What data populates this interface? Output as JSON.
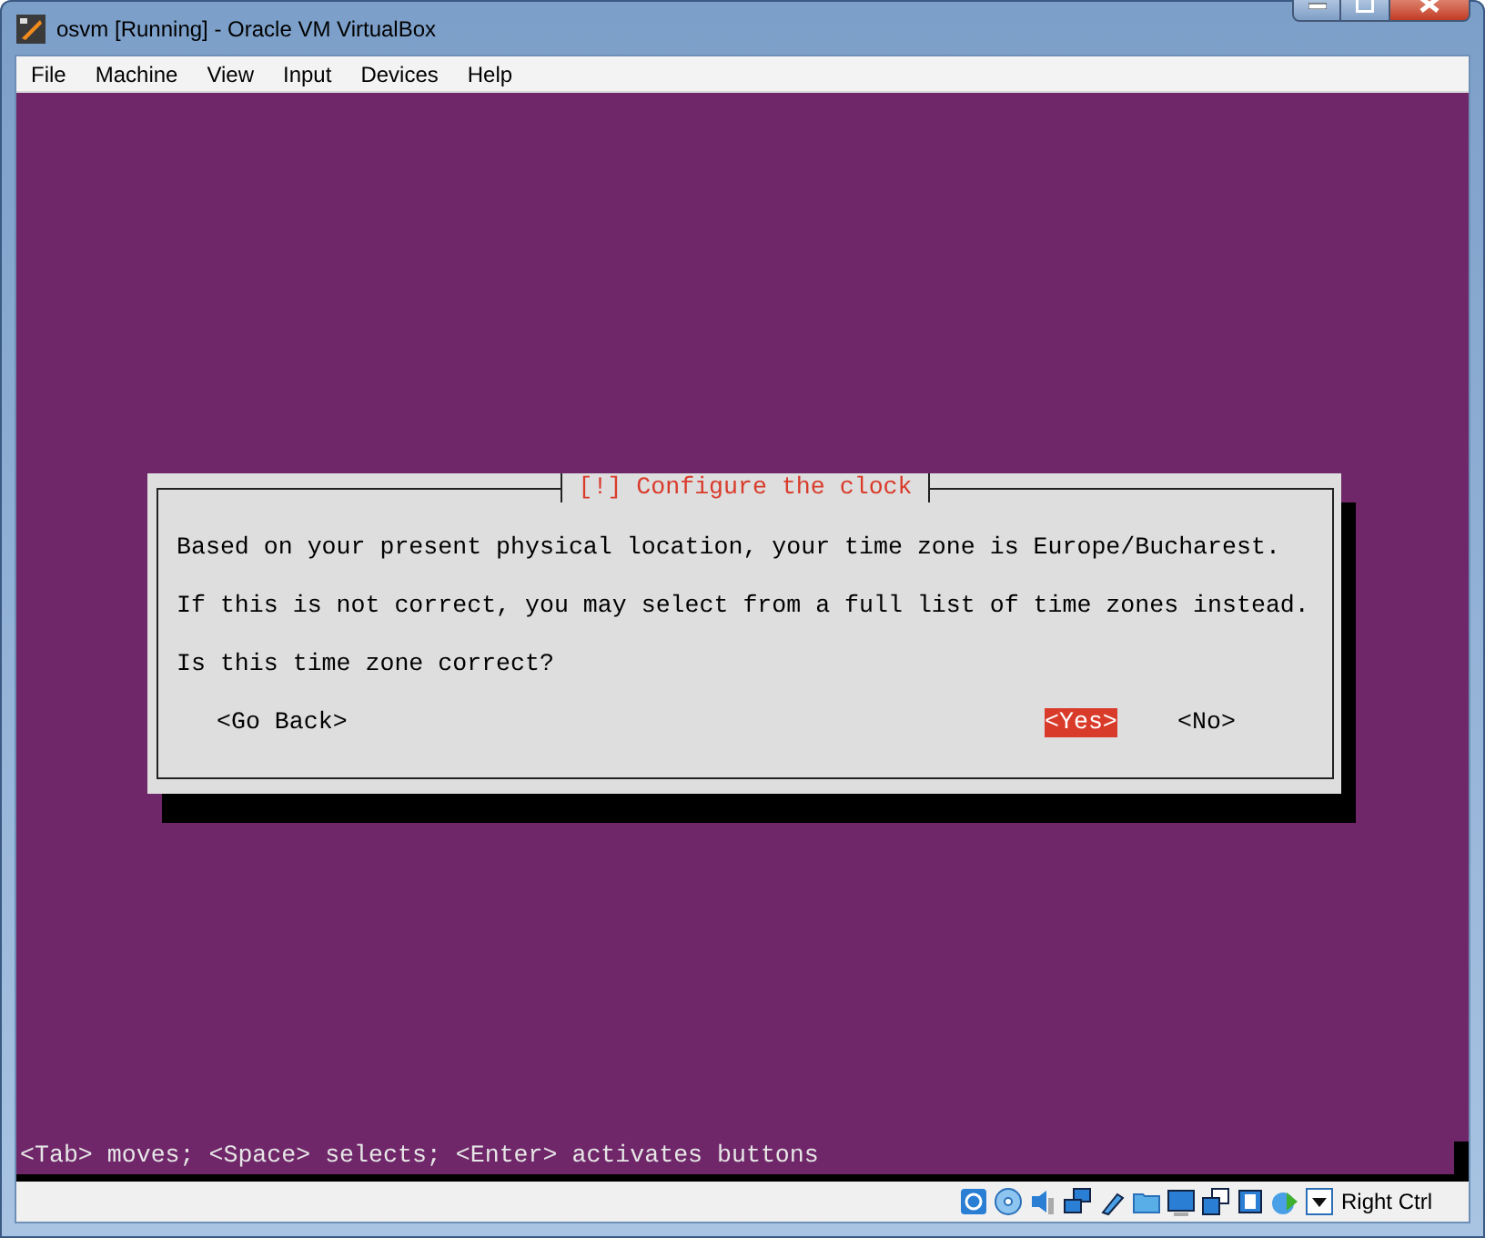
{
  "window": {
    "title": "osvm [Running] - Oracle VM VirtualBox"
  },
  "menu": [
    "File",
    "Machine",
    "View",
    "Input",
    "Devices",
    "Help"
  ],
  "dialog": {
    "title": "[!] Configure the clock",
    "paragraphs": [
      "Based on your present physical location, your time zone is Europe/Bucharest.",
      "If this is not correct, you may select from a full list of time zones instead.",
      "Is this time zone correct?"
    ],
    "buttons": [
      {
        "label": "<Go Back>",
        "selected": false
      },
      {
        "label": "<Yes>",
        "selected": true
      },
      {
        "label": "<No>",
        "selected": false
      }
    ]
  },
  "help_line": "<Tab> moves; <Space> selects; <Enter> activates buttons",
  "status_bar": {
    "host_key": "Right Ctrl"
  }
}
